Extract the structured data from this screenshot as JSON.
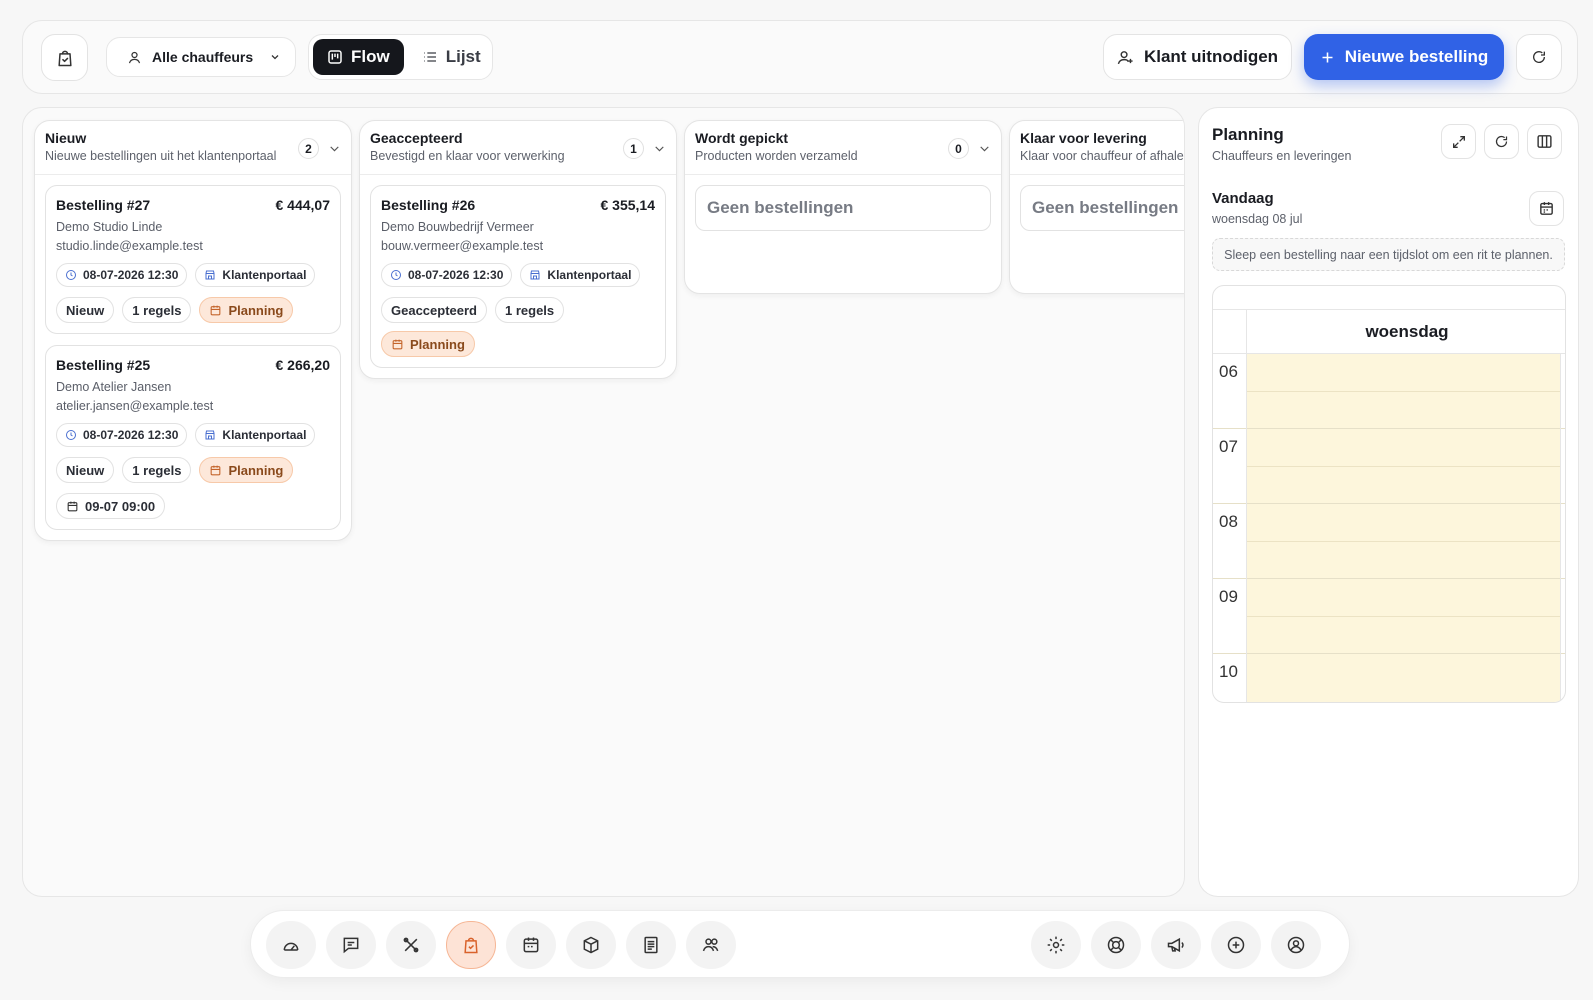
{
  "topbar": {
    "driver_select": "Alle chauffeurs",
    "view_flow": "Flow",
    "view_list": "Lijst",
    "invite_label": "Klant uitnodigen",
    "new_order_label": "Nieuwe bestelling"
  },
  "columns": [
    {
      "title": "Nieuw",
      "subtitle": "Nieuwe bestellingen uit het klantenportaal",
      "count": "2",
      "orders": [
        {
          "title": "Bestelling #27",
          "amount": "€ 444,07",
          "company": "Demo Studio Linde",
          "email": "studio.linde@example.test",
          "datetime": "08-07-2026 12:30",
          "source": "Klantenportaal",
          "status": "Nieuw",
          "lines": "1 regels",
          "planning": "Planning"
        },
        {
          "title": "Bestelling #25",
          "amount": "€ 266,20",
          "company": "Demo Atelier Jansen",
          "email": "atelier.jansen@example.test",
          "datetime": "08-07-2026 12:30",
          "source": "Klantenportaal",
          "status": "Nieuw",
          "lines": "1 regels",
          "planning": "Planning",
          "scheduled": "09-07 09:00"
        }
      ]
    },
    {
      "title": "Geaccepteerd",
      "subtitle": "Bevestigd en klaar voor verwerking",
      "count": "1",
      "orders": [
        {
          "title": "Bestelling #26",
          "amount": "€ 355,14",
          "company": "Demo Bouwbedrijf Vermeer",
          "email": "bouw.vermeer@example.test",
          "datetime": "08-07-2026 12:30",
          "source": "Klantenportaal",
          "status": "Geaccepteerd",
          "lines": "1 regels",
          "planning": "Planning"
        }
      ]
    },
    {
      "title": "Wordt gepickt",
      "subtitle": "Producten worden verzameld",
      "count": "0",
      "empty": "Geen bestellingen"
    },
    {
      "title": "Klaar voor levering",
      "subtitle": "Klaar voor chauffeur of afhalen",
      "empty": "Geen bestellingen"
    }
  ],
  "planning": {
    "title": "Planning",
    "subtitle": "Chauffeurs en leveringen",
    "today": "Vandaag",
    "today_date": "woensdag 08 jul",
    "hint": "Sleep een bestelling naar een tijdslot om een rit te plannen.",
    "day_label": "woensdag",
    "hours": [
      "06",
      "07",
      "08",
      "09",
      "10"
    ]
  },
  "dock": {
    "left": [
      "dashboard-icon",
      "messages-icon",
      "tools-icon",
      "orders-icon",
      "calendar-icon",
      "box-icon",
      "invoice-icon",
      "users-icon"
    ],
    "right": [
      "settings-icon",
      "support-icon",
      "megaphone-icon",
      "plus-circle-icon",
      "account-icon"
    ],
    "active": "orders-icon",
    "active_color": "#d9622b"
  },
  "colors": {
    "primary": "#3062e6",
    "planning_chip": "#fde8da",
    "slot": "#fdf6dc"
  }
}
